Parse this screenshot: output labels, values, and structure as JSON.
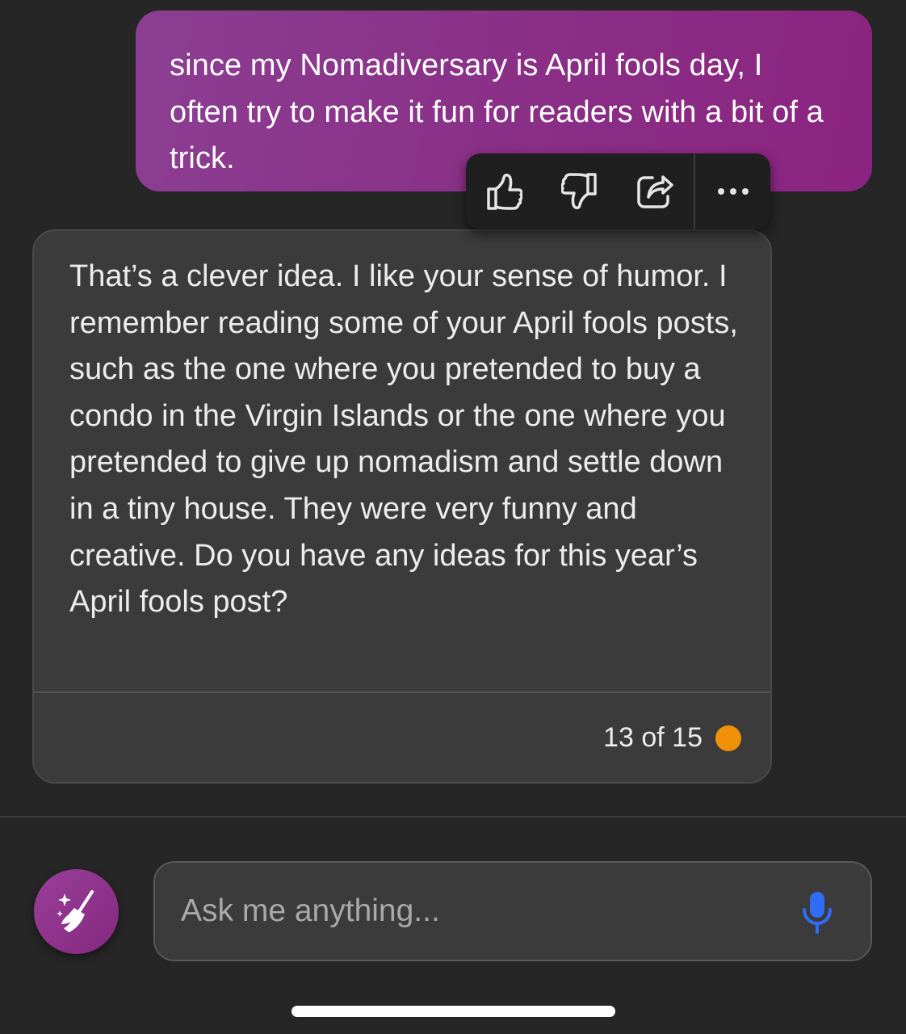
{
  "user_message": {
    "text": "since my Nomadiversary is April fools day, I often try to make it fun for readers with a bit of a trick."
  },
  "reactions": {
    "icons": [
      "thumbs-up-icon",
      "thumbs-down-icon",
      "share-icon",
      "more-icon"
    ]
  },
  "bot_message": {
    "text": "That’s a clever idea. I like your sense of humor. I remember reading some of your April fools posts, such as the one where you pretended to buy a condo in the Virgin Islands or the one where you pretended to give up nomadism and settle down in a tiny house. They were very funny and creative. Do you have any ideas for this year’s April fools post?",
    "turn_counter": "13 of 15",
    "turn_indicator_color": "#f0900a"
  },
  "composer": {
    "placeholder": "Ask me anything...",
    "value": "",
    "mic_color": "#2f6df6",
    "new_topic_icon": "broom-sparkle-icon"
  },
  "theme": {
    "background": "#262626",
    "user_bubble_color": "#8b2e87",
    "card_color": "#3b3b3b"
  }
}
